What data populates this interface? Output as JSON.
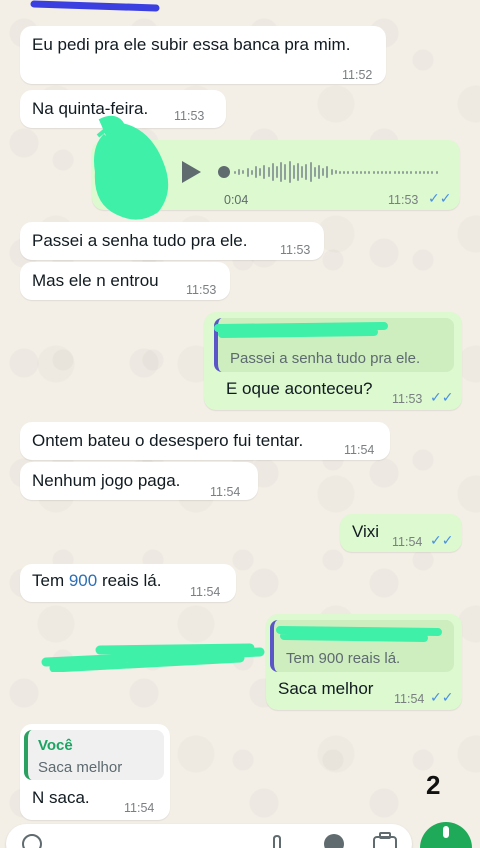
{
  "messages": [
    {
      "text": "Eu pedi pra ele subir essa banca pra mim.",
      "time": "11:52"
    },
    {
      "text": "Na quinta-feira.",
      "time": "11:53"
    },
    {
      "duration": "0:04",
      "time": "11:53"
    },
    {
      "text": "Passei a senha tudo pra ele.",
      "time": "11:53"
    },
    {
      "text": "Mas ele n entrou",
      "time": "11:53"
    },
    {
      "quote": "Passei a senha tudo pra ele.",
      "text": "E oque aconteceu?",
      "time": "11:53"
    },
    {
      "text": "Ontem bateu o desespero fui tentar.",
      "time": "11:54"
    },
    {
      "text": "Nenhum jogo paga.",
      "time": "11:54"
    },
    {
      "text": "Vixi",
      "time": "11:54"
    },
    {
      "text_before": "Tem ",
      "number": "900",
      "text_after": " reais lá.",
      "time": "11:54"
    },
    {
      "quote": "Tem 900 reais lá.",
      "text": "Saca melhor",
      "time": "11:54"
    },
    {
      "quote_author": "Você",
      "quote": "Saca melhor",
      "text": "N saca.",
      "time": "11:54"
    }
  ],
  "page_marker": "2",
  "colors": {
    "incoming": "#ffffff",
    "outgoing": "#dcf9cf",
    "read_ticks": "#4a90e2",
    "quote_bar_out": "#5b56c7",
    "quote_bar_in": "#2aa160",
    "scribble": "#3ef0a8",
    "mic_button": "#1faa59"
  },
  "icons": {
    "play": "play-icon",
    "read": "double-check-icon",
    "mic": "mic-icon",
    "emoji": "emoji-icon",
    "attach": "attach-icon",
    "camera": "camera-icon"
  }
}
